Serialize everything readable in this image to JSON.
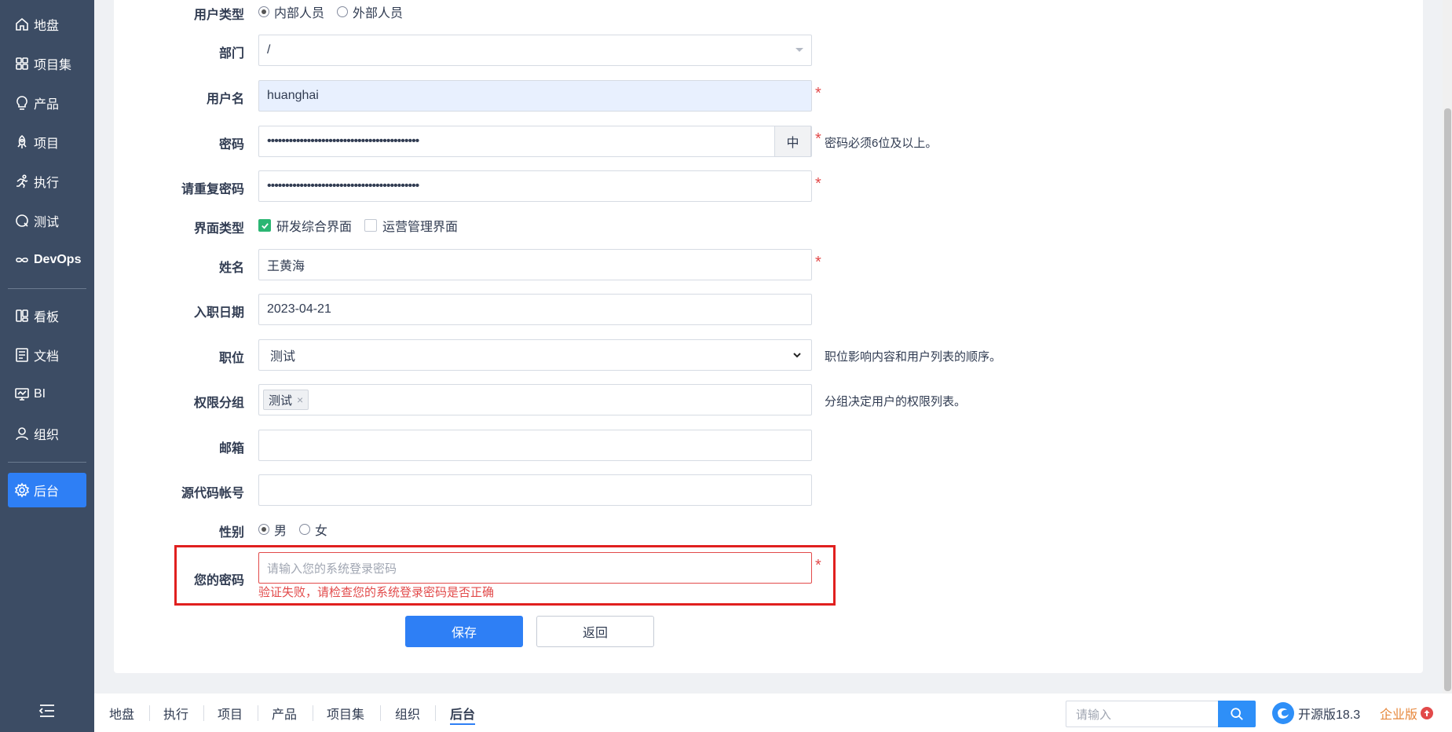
{
  "sidebar": {
    "items": [
      {
        "label": "地盘",
        "icon": "home-icon"
      },
      {
        "label": "项目集",
        "icon": "grid-icon"
      },
      {
        "label": "产品",
        "icon": "lightbulb-icon"
      },
      {
        "label": "项目",
        "icon": "rocket-icon"
      },
      {
        "label": "执行",
        "icon": "run-icon"
      },
      {
        "label": "测试",
        "icon": "test-icon"
      },
      {
        "label": "DevOps",
        "icon": "infinity-icon"
      },
      {
        "label": "看板",
        "icon": "kanban-icon"
      },
      {
        "label": "文档",
        "icon": "doc-icon"
      },
      {
        "label": "BI",
        "icon": "monitor-icon"
      },
      {
        "label": "组织",
        "icon": "user-icon"
      },
      {
        "label": "后台",
        "icon": "gear-icon",
        "active": true
      }
    ]
  },
  "form": {
    "user_type": {
      "label": "用户类型",
      "options": [
        "内部人员",
        "外部人员"
      ],
      "selected": "内部人员"
    },
    "dept": {
      "label": "部门",
      "value": "/"
    },
    "username": {
      "label": "用户名",
      "value": "huanghai",
      "required": "*"
    },
    "password": {
      "label": "密码",
      "value": "••••••••••••••••••••••••••••••••••••••••••",
      "strength": "中",
      "required": "*",
      "tip": "密码必须6位及以上。"
    },
    "password_repeat": {
      "label": "请重复密码",
      "value": "••••••••••••••••••••••••••••••••••••••••••",
      "required": "*"
    },
    "ui_type": {
      "label": "界面类型",
      "options": [
        "研发综合界面",
        "运营管理界面"
      ],
      "checked": [
        "研发综合界面"
      ]
    },
    "realname": {
      "label": "姓名",
      "value": "王黄海",
      "required": "*"
    },
    "join_date": {
      "label": "入职日期",
      "value": "2023-04-21"
    },
    "role": {
      "label": "职位",
      "value": "测试",
      "tip": "职位影响内容和用户列表的顺序。"
    },
    "group": {
      "label": "权限分组",
      "tags": [
        "测试"
      ],
      "tip": "分组决定用户的权限列表。"
    },
    "email": {
      "label": "邮箱",
      "value": ""
    },
    "commiter": {
      "label": "源代码帐号",
      "value": ""
    },
    "gender": {
      "label": "性别",
      "options": [
        "男",
        "女"
      ],
      "selected": "男"
    },
    "verify_password": {
      "label": "您的密码",
      "placeholder": "请输入您的系统登录密码",
      "required": "*",
      "error": "验证失败，请检查您的系统登录密码是否正确"
    },
    "save_label": "保存",
    "back_label": "返回"
  },
  "bottom": {
    "nav": [
      "地盘",
      "执行",
      "项目",
      "产品",
      "项目集",
      "组织",
      "后台"
    ],
    "active": "后台",
    "search_placeholder": "请输入",
    "version": "开源版18.3",
    "enterprise": "企业版"
  },
  "colors": {
    "sidebar_bg": "#3c4c64",
    "primary": "#2e7ff5",
    "error": "#e24a4a",
    "highlight": "#e0201f",
    "enterprise": "#e6873b"
  }
}
